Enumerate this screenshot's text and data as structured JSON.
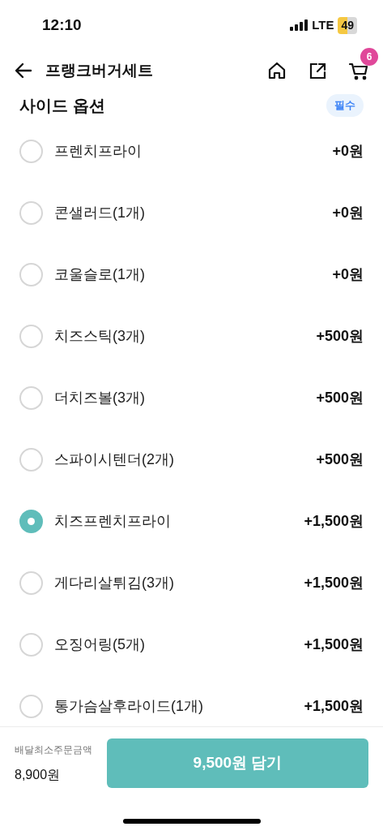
{
  "status_bar": {
    "time": "12:10",
    "network": "LTE",
    "battery": "49"
  },
  "header": {
    "title": "프랭크버거세트",
    "cart_count": "6"
  },
  "section": {
    "title": "사이드 옵션",
    "badge": "필수"
  },
  "options": [
    {
      "label": "프렌치프라이",
      "price": "+0원",
      "selected": false
    },
    {
      "label": "콘샐러드(1개)",
      "price": "+0원",
      "selected": false
    },
    {
      "label": "코울슬로(1개)",
      "price": "+0원",
      "selected": false
    },
    {
      "label": "치즈스틱(3개)",
      "price": "+500원",
      "selected": false
    },
    {
      "label": "더치즈볼(3개)",
      "price": "+500원",
      "selected": false
    },
    {
      "label": "스파이시텐더(2개)",
      "price": "+500원",
      "selected": false
    },
    {
      "label": "치즈프렌치프라이",
      "price": "+1,500원",
      "selected": true
    },
    {
      "label": "게다리살튀김(3개)",
      "price": "+1,500원",
      "selected": false
    },
    {
      "label": "오징어링(5개)",
      "price": "+1,500원",
      "selected": false
    },
    {
      "label": "통가슴살후라이드(1개)",
      "price": "+1,500원",
      "selected": false
    }
  ],
  "footer": {
    "min_order_label": "배달최소주문금액",
    "min_order_value": "8,900원",
    "add_button": "9,500원 담기"
  }
}
